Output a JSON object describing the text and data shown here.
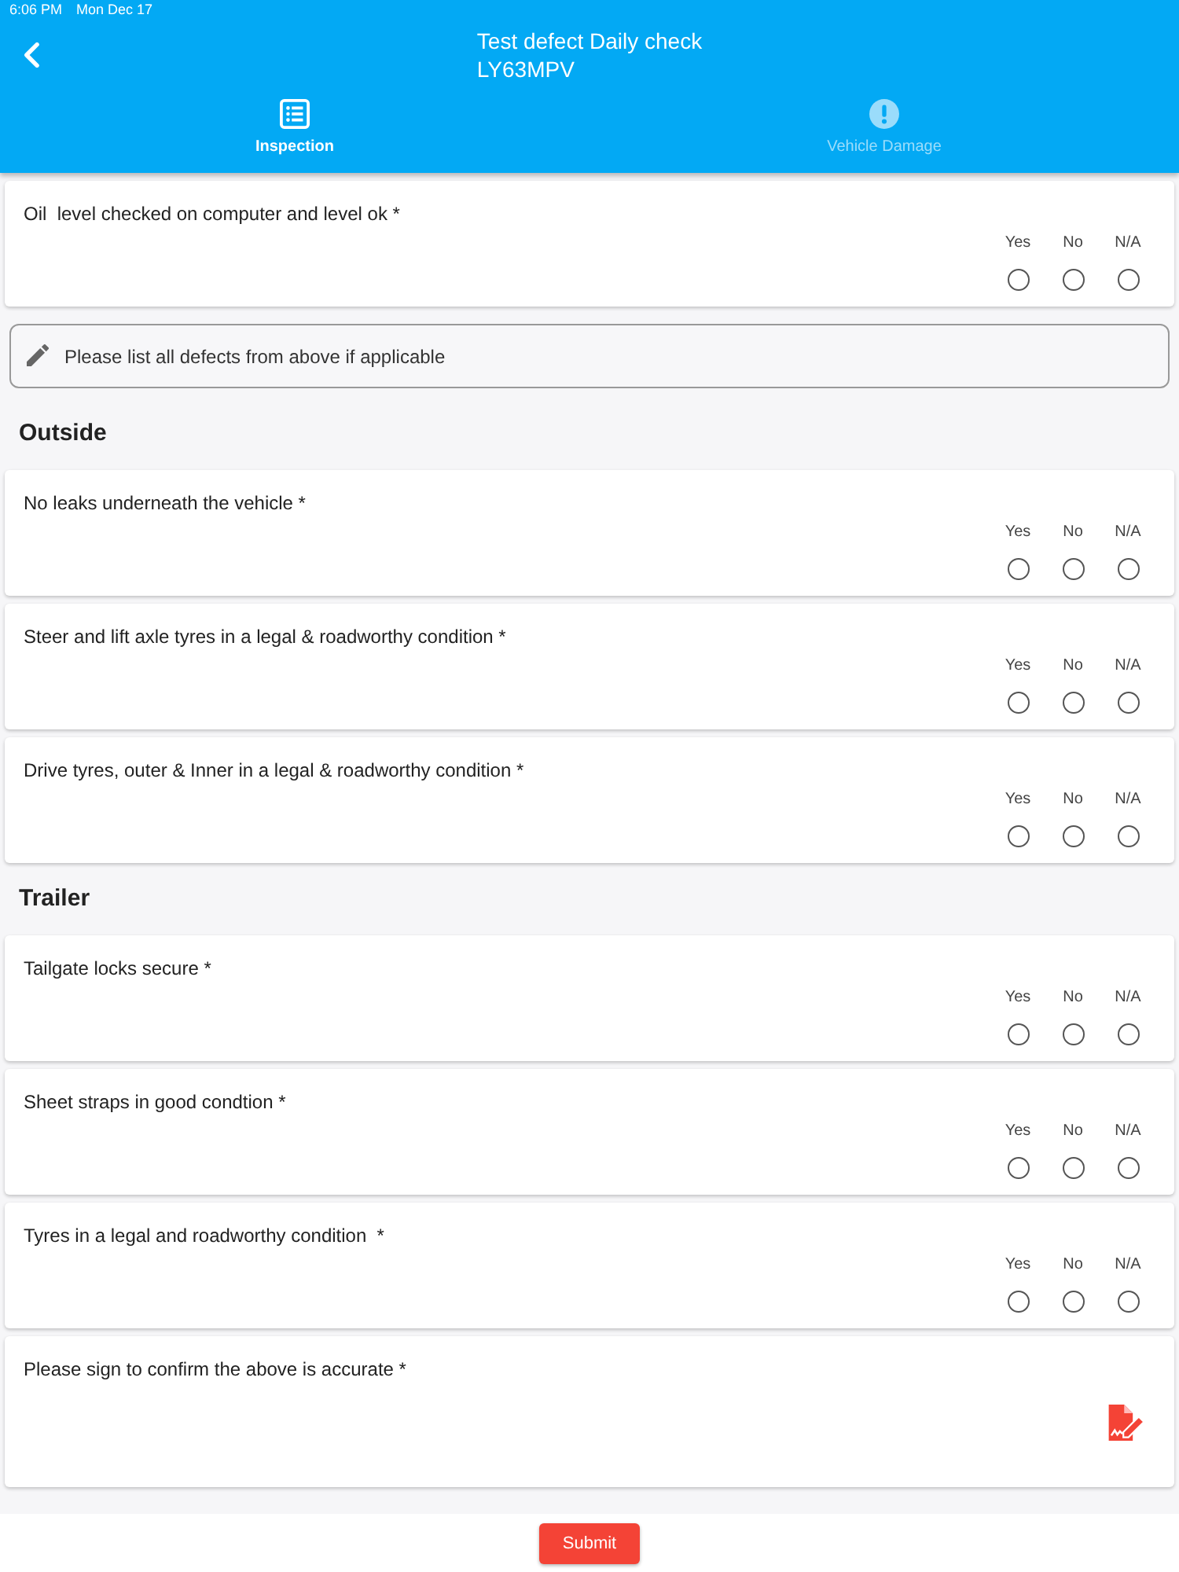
{
  "status_bar": {
    "time": "6:06 PM",
    "date": "Mon Dec 17"
  },
  "header": {
    "title": "Test defect Daily check",
    "subtitle": "LY63MPV"
  },
  "tabs": [
    {
      "label": "Inspection",
      "selected": true
    },
    {
      "label": "Vehicle Damage",
      "selected": false
    }
  ],
  "sections": [
    {
      "items": [
        {
          "kind": "question",
          "text": "Oil  level checked on computer and level ok *",
          "options": [
            {
              "label": "Yes",
              "selected": false
            },
            {
              "label": "No",
              "selected": false
            },
            {
              "label": "N/A",
              "selected": false
            }
          ]
        },
        {
          "kind": "text_field",
          "placeholder": "Please list all defects from above if applicable"
        }
      ]
    },
    {
      "heading": "Outside",
      "items": [
        {
          "kind": "question",
          "text": "No leaks underneath the vehicle *",
          "options": [
            {
              "label": "Yes",
              "selected": false
            },
            {
              "label": "No",
              "selected": false
            },
            {
              "label": "N/A",
              "selected": false
            }
          ]
        },
        {
          "kind": "question",
          "text": "Steer and lift axle tyres in a legal & roadworthy condition *",
          "options": [
            {
              "label": "Yes",
              "selected": false
            },
            {
              "label": "No",
              "selected": false
            },
            {
              "label": "N/A",
              "selected": false
            }
          ]
        },
        {
          "kind": "question",
          "text": "Drive tyres, outer & Inner in a legal & roadworthy condition *",
          "options": [
            {
              "label": "Yes",
              "selected": false
            },
            {
              "label": "No",
              "selected": false
            },
            {
              "label": "N/A",
              "selected": false
            }
          ]
        }
      ]
    },
    {
      "heading": "Trailer",
      "items": [
        {
          "kind": "question",
          "text": "Tailgate locks secure *",
          "options": [
            {
              "label": "Yes",
              "selected": false
            },
            {
              "label": "No",
              "selected": false
            },
            {
              "label": "N/A",
              "selected": false
            }
          ]
        },
        {
          "kind": "question",
          "text": "Sheet straps in good condtion *",
          "options": [
            {
              "label": "Yes",
              "selected": false
            },
            {
              "label": "No",
              "selected": false
            },
            {
              "label": "N/A",
              "selected": false
            }
          ]
        },
        {
          "kind": "question",
          "text": "Tyres in a legal and roadworthy condition  *",
          "options": [
            {
              "label": "Yes",
              "selected": false
            },
            {
              "label": "No",
              "selected": false
            },
            {
              "label": "N/A",
              "selected": false
            }
          ]
        },
        {
          "kind": "signature",
          "text": "Please sign to confirm the above is accurate *"
        }
      ]
    }
  ],
  "submit": {
    "label": "Submit"
  }
}
